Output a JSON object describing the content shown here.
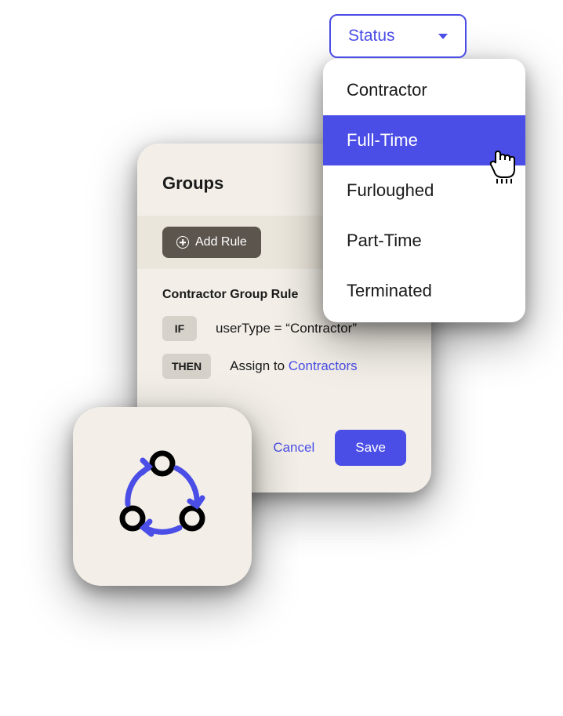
{
  "groups": {
    "title": "Groups",
    "addRuleLabel": "Add Rule",
    "rule": {
      "title": "Contractor Group Rule",
      "ifBadge": "IF",
      "ifText": "userType = “Contractor”",
      "thenBadge": "THEN",
      "thenTextPrefix": "Assign to ",
      "thenLink": "Contractors"
    },
    "actions": {
      "cancel": "Cancel",
      "save": "Save"
    }
  },
  "statusDropdown": {
    "label": "Status",
    "options": [
      "Contractor",
      "Full-Time",
      "Furloughed",
      "Part-Time",
      "Terminated"
    ],
    "highlightedIndex": 1
  },
  "icons": {
    "plus": "plus-icon",
    "caretDown": "caret-down-icon",
    "pointer": "pointer-cursor-icon",
    "cycle": "cycle-icon"
  },
  "colors": {
    "accent": "#4a4de6",
    "panelBg": "#f3efe8",
    "badgeBg": "#d6d1c9",
    "darkButton": "#5c554d"
  }
}
